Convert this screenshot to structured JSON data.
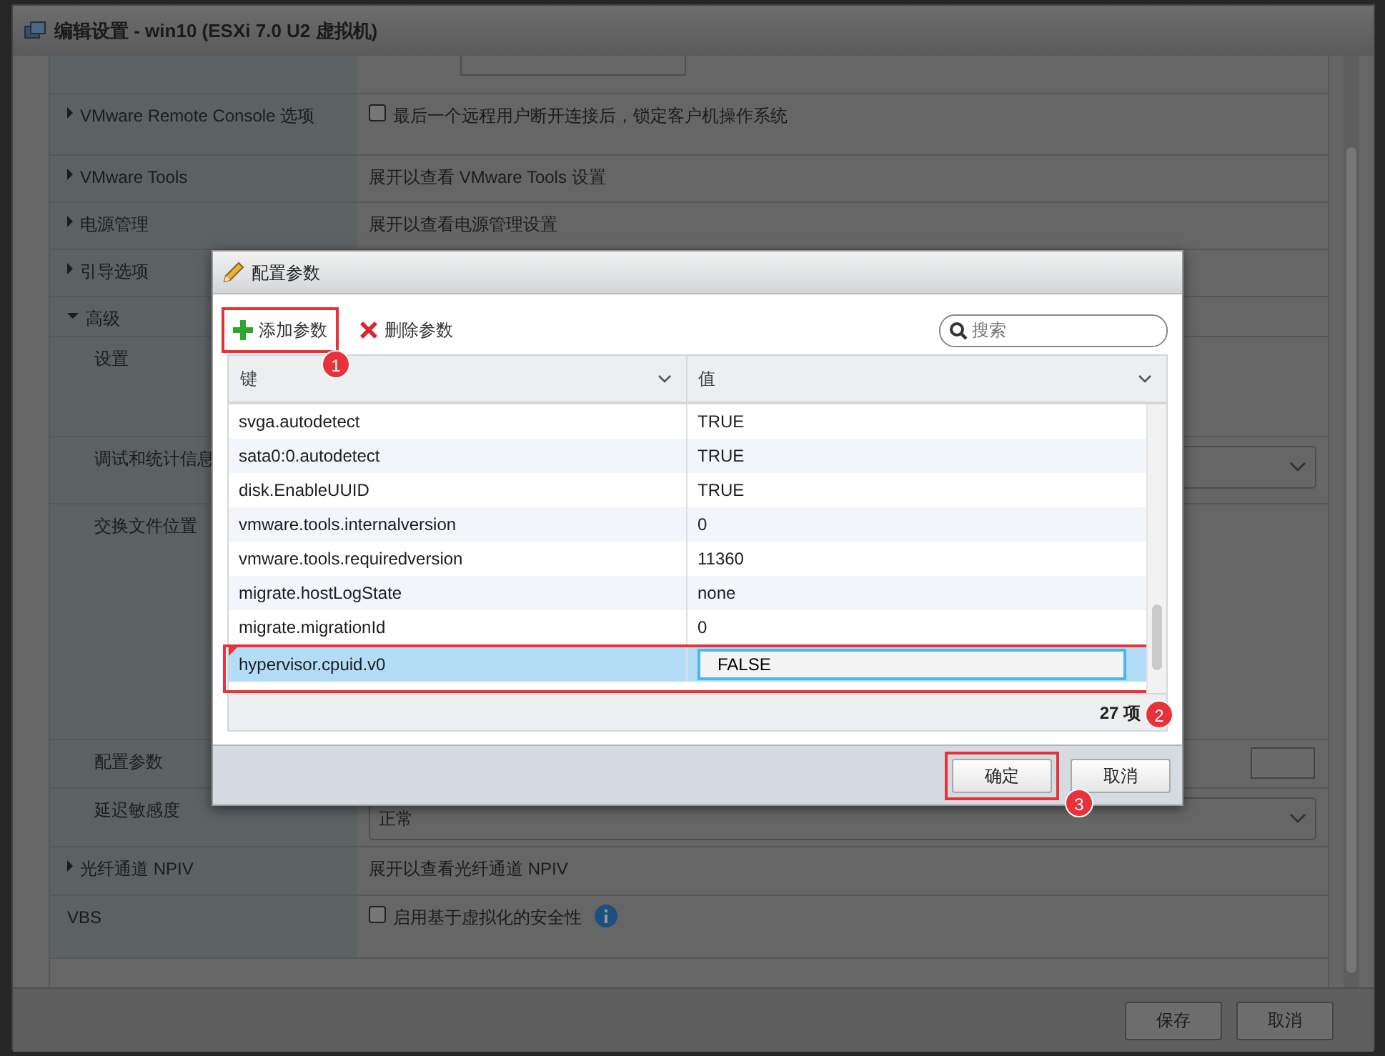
{
  "window": {
    "title": "编辑设置 - win10 (ESXi 7.0 U2 虚拟机)"
  },
  "settings": [
    {
      "kind": "partial",
      "value": {
        "kind": "field"
      }
    },
    {
      "kind": "section",
      "label": "VMware Remote Console 选项",
      "expanded": false,
      "value": {
        "kind": "checkbox",
        "checked": false,
        "text": "最后一个远程用户断开连接后，锁定客户机操作系统"
      }
    },
    {
      "kind": "section",
      "label": "VMware Tools",
      "expanded": false,
      "value": {
        "kind": "text",
        "text": "展开以查看 VMware Tools 设置"
      }
    },
    {
      "kind": "section",
      "label": "电源管理",
      "expanded": false,
      "value": {
        "kind": "text",
        "text": "展开以查看电源管理设置"
      }
    },
    {
      "kind": "section",
      "label": "引导选项",
      "expanded": false,
      "value": {
        "kind": "none"
      }
    },
    {
      "kind": "section",
      "label": "高级",
      "expanded": true,
      "value": {
        "kind": "none"
      }
    },
    {
      "kind": "sub",
      "label": "设置",
      "value": {
        "kind": "none"
      }
    },
    {
      "kind": "sub",
      "label": "调试和统计信息",
      "value": {
        "kind": "select"
      }
    },
    {
      "kind": "sub",
      "label": "交换文件位置",
      "value": {
        "kind": "none"
      }
    },
    {
      "kind": "sub",
      "label": "配置参数",
      "value": {
        "kind": "button"
      }
    },
    {
      "kind": "sub",
      "label": "延迟敏感度",
      "value": {
        "kind": "select",
        "text": "正常"
      }
    },
    {
      "kind": "section",
      "label": "光纤通道 NPIV",
      "expanded": false,
      "value": {
        "kind": "text",
        "text": "展开以查看光纤通道 NPIV"
      }
    },
    {
      "kind": "plain",
      "label": "VBS",
      "value": {
        "kind": "checkbox",
        "checked": false,
        "text": "启用基于虚拟化的安全性",
        "info": true
      }
    }
  ],
  "footer_buttons": [
    "保存",
    "取消"
  ],
  "dialog": {
    "title": "配置参数",
    "toolbar": [
      {
        "kind": "add",
        "label": "添加参数",
        "callout": "1"
      },
      {
        "kind": "remove",
        "label": "删除参数"
      }
    ],
    "search": {
      "placeholder": "搜索"
    },
    "columns": [
      "键",
      "值"
    ],
    "rows": [
      {
        "key": "svga.autodetect",
        "value": "TRUE",
        "selected": false,
        "editing": false,
        "modified": false
      },
      {
        "key": "sata0:0.autodetect",
        "value": "TRUE",
        "selected": false,
        "editing": false,
        "modified": false
      },
      {
        "key": "disk.EnableUUID",
        "value": "TRUE",
        "selected": false,
        "editing": false,
        "modified": false
      },
      {
        "key": "vmware.tools.internalversion",
        "value": "0",
        "selected": false,
        "editing": false,
        "modified": false
      },
      {
        "key": "vmware.tools.requiredversion",
        "value": "11360",
        "selected": false,
        "editing": false,
        "modified": false
      },
      {
        "key": "migrate.hostLogState",
        "value": "none",
        "selected": false,
        "editing": false,
        "modified": false
      },
      {
        "key": "migrate.migrationId",
        "value": "0",
        "selected": false,
        "editing": false,
        "modified": false
      },
      {
        "key": "hypervisor.cpuid.v0",
        "value": "FALSE",
        "selected": true,
        "editing": true,
        "modified": true,
        "callout": "2"
      }
    ],
    "count": "27 项",
    "buttons": [
      {
        "label": "确定",
        "callout": "3"
      },
      {
        "label": "取消"
      }
    ]
  }
}
